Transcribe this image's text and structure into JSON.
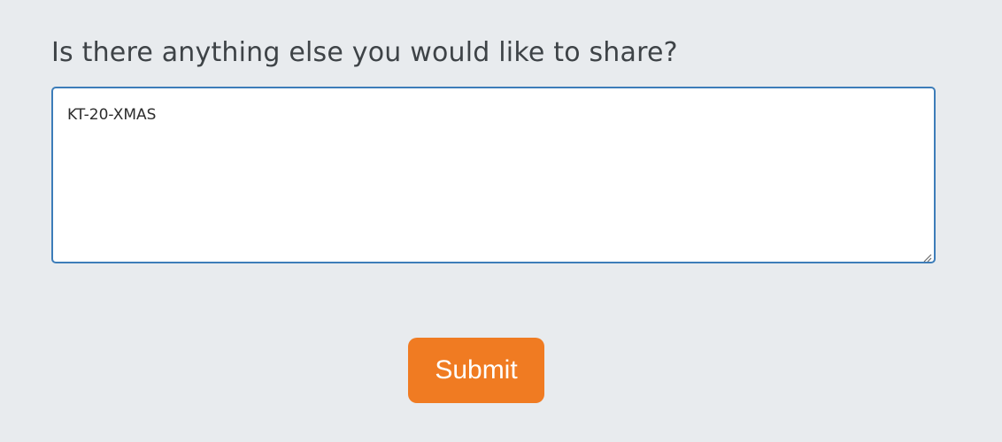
{
  "form": {
    "question": "Is there anything else you would like to share?",
    "answer_value": "KT-20-XMAS",
    "submit_label": "Submit"
  },
  "colors": {
    "background": "#e8ebee",
    "textarea_border": "#3d7db9",
    "submit_background": "#f07b22",
    "submit_text": "#ffffff",
    "question_text": "#3e4347"
  },
  "icons": {
    "resize_handle": "resize-grip-icon"
  }
}
